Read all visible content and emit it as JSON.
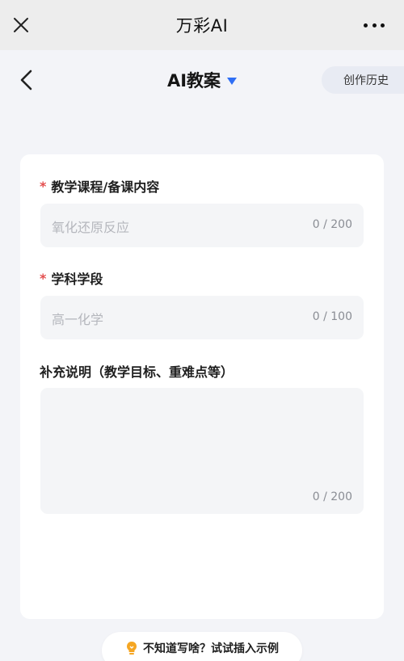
{
  "topbar": {
    "title": "万彩AI"
  },
  "header": {
    "title": "AI教案",
    "history_label": "创作历史"
  },
  "form": {
    "fields": [
      {
        "label": "教学课程/备课内容",
        "required_mark": "*",
        "placeholder": "氧化还原反应",
        "counter": "0 / 200"
      },
      {
        "label": "学科学段",
        "required_mark": "*",
        "placeholder": "高一化学",
        "counter": "0 / 100"
      },
      {
        "label": "补充说明（教学目标、重难点等）",
        "required_mark": "",
        "placeholder": "",
        "counter": "0 / 200"
      }
    ]
  },
  "hint": {
    "text": "不知道写啥？试试插入示例"
  },
  "colors": {
    "accent": "#2f6ff5",
    "required": "#e34d4d",
    "hint_bulb": "#f5a623"
  },
  "icons": [
    "close-icon",
    "more-icon",
    "back-icon",
    "caret-down-icon",
    "bulb-icon"
  ]
}
